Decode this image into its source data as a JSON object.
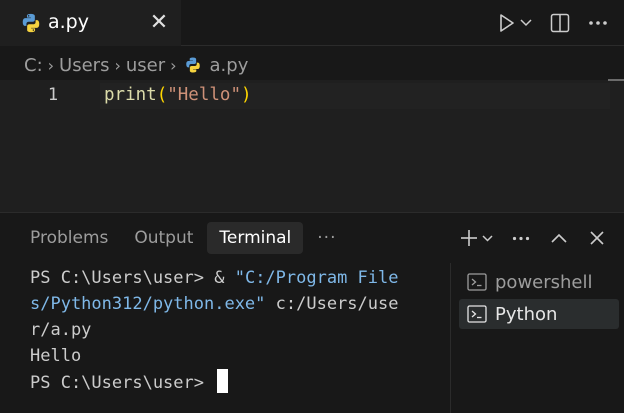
{
  "tab": {
    "filename": "a.py",
    "close_glyph": "✕"
  },
  "breadcrumb": {
    "items": [
      "C:",
      "Users",
      "user"
    ],
    "file": "a.py"
  },
  "editor": {
    "line_number": "1",
    "code": {
      "fn": "print",
      "open": "(",
      "str": "\"Hello\"",
      "close": ")"
    }
  },
  "panel": {
    "tabs": [
      "Problems",
      "Output",
      "Terminal"
    ],
    "active_tab": "Terminal",
    "more": "···"
  },
  "terminal": {
    "line1_prompt": "PS C:\\Users\\user> ",
    "line1_op": "& ",
    "line1_str": "\"C:/Program File",
    "line2_str": "s/Python312/python.exe\"",
    "line2_arg": " c:/Users/use",
    "line3_arg": "r/a.py",
    "line4": "Hello",
    "line5_prompt": "PS C:\\Users\\user> "
  },
  "terminal_list": {
    "items": [
      "powershell",
      "Python"
    ],
    "active": "Python"
  },
  "colors": {
    "accent_blue": "#3c79b8",
    "python_yellow": "#f5d33f",
    "string": "#ce9178"
  },
  "icons": [
    "python-icon",
    "close-icon",
    "run-icon",
    "chevron-down-icon",
    "split-editor-icon",
    "more-icon",
    "plus-icon",
    "chevron-up-icon",
    "terminal-icon"
  ]
}
